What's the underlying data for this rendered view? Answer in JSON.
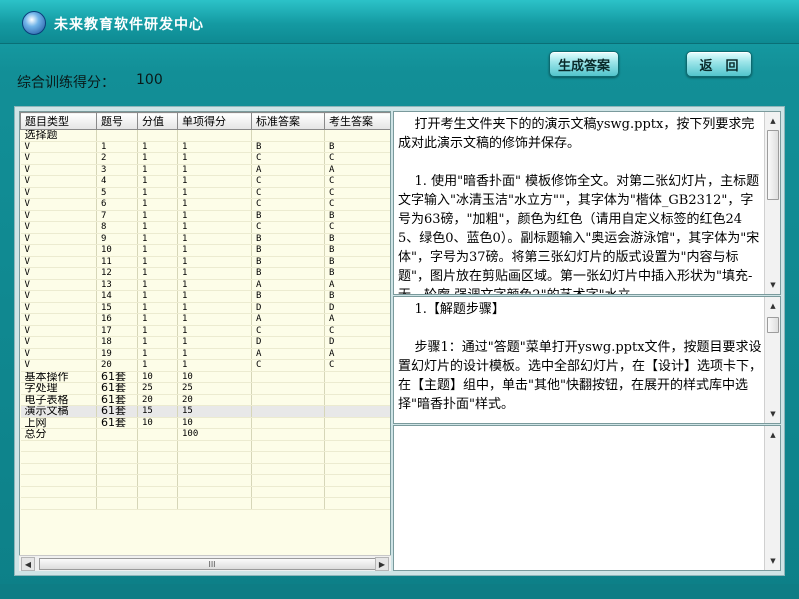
{
  "app": {
    "title": "未来教育软件研发中心"
  },
  "header": {
    "score_label": "综合训练得分：",
    "score_value": "100",
    "generate_label": "生成答案",
    "back_label": "返　回"
  },
  "grid": {
    "columns": [
      "题目类型",
      "题号",
      "分值",
      "单项得分",
      "标准答案",
      "考生答案"
    ],
    "rows": [
      [
        "选择题",
        "",
        "",
        "",
        "",
        ""
      ],
      [
        "V",
        "1",
        "1",
        "1",
        "B",
        "B"
      ],
      [
        "V",
        "2",
        "1",
        "1",
        "C",
        "C"
      ],
      [
        "V",
        "3",
        "1",
        "1",
        "A",
        "A"
      ],
      [
        "V",
        "4",
        "1",
        "1",
        "C",
        "C"
      ],
      [
        "V",
        "5",
        "1",
        "1",
        "C",
        "C"
      ],
      [
        "V",
        "6",
        "1",
        "1",
        "C",
        "C"
      ],
      [
        "V",
        "7",
        "1",
        "1",
        "B",
        "B"
      ],
      [
        "V",
        "8",
        "1",
        "1",
        "C",
        "C"
      ],
      [
        "V",
        "9",
        "1",
        "1",
        "B",
        "B"
      ],
      [
        "V",
        "10",
        "1",
        "1",
        "B",
        "B"
      ],
      [
        "V",
        "11",
        "1",
        "1",
        "B",
        "B"
      ],
      [
        "V",
        "12",
        "1",
        "1",
        "B",
        "B"
      ],
      [
        "V",
        "13",
        "1",
        "1",
        "A",
        "A"
      ],
      [
        "V",
        "14",
        "1",
        "1",
        "B",
        "B"
      ],
      [
        "V",
        "15",
        "1",
        "1",
        "D",
        "D"
      ],
      [
        "V",
        "16",
        "1",
        "1",
        "A",
        "A"
      ],
      [
        "V",
        "17",
        "1",
        "1",
        "C",
        "C"
      ],
      [
        "V",
        "18",
        "1",
        "1",
        "D",
        "D"
      ],
      [
        "V",
        "19",
        "1",
        "1",
        "A",
        "A"
      ],
      [
        "V",
        "20",
        "1",
        "1",
        "C",
        "C"
      ],
      [
        "基本操作",
        "61套",
        "10",
        "10",
        "",
        ""
      ],
      [
        "字处理",
        "61套",
        "25",
        "25",
        "",
        ""
      ],
      [
        "电子表格",
        "61套",
        "20",
        "20",
        "",
        ""
      ],
      [
        "演示文稿",
        "61套",
        "15",
        "15",
        "",
        ""
      ],
      [
        "上网",
        "61套",
        "10",
        "10",
        "",
        ""
      ],
      [
        "总分",
        "",
        "",
        "100",
        "",
        ""
      ]
    ],
    "selected_row": 24,
    "scroll_thumb_glyph": "III"
  },
  "pane1": {
    "text": "    打开考生文件夹下的的演示文稿yswg.pptx，按下列要求完成对此演示文稿的修饰并保存。\n\n    1. 使用\"暗香扑面\" 模板修饰全文。对第二张幻灯片，主标题文字输入\"冰清玉洁\"水立方\"\"，其字体为\"楷体_GB2312\"，字号为63磅，\"加粗\"，颜色为红色（请用自定义标签的红色245、绿色0、蓝色0）。副标题输入\"奥运会游泳馆\"，其字体为\"宋体\"，字号为37磅。将第三张幻灯片的版式设置为\"内容与标题\"，图片放在剪贴画区域。第一张幻灯片中插入形状为\"填充-无，轮廓-强调文字颜色2\"的艺术字\"水立"
  },
  "pane2": {
    "text": "    1.【解题步骤】\n\n    步骤1：通过\"答题\"菜单打开yswg.pptx文件，按题目要求设置幻灯片的设计模板。选中全部幻灯片，在【设计】选项卡下，在【主题】组中，单击\"其他\"快翻按钮，在展开的样式库中选择\"暗香扑面\"样式。"
  },
  "colors": {
    "window_bg": "#0f7f86",
    "title_text": "#ffffff",
    "grid_bg": "#fdfde8"
  }
}
